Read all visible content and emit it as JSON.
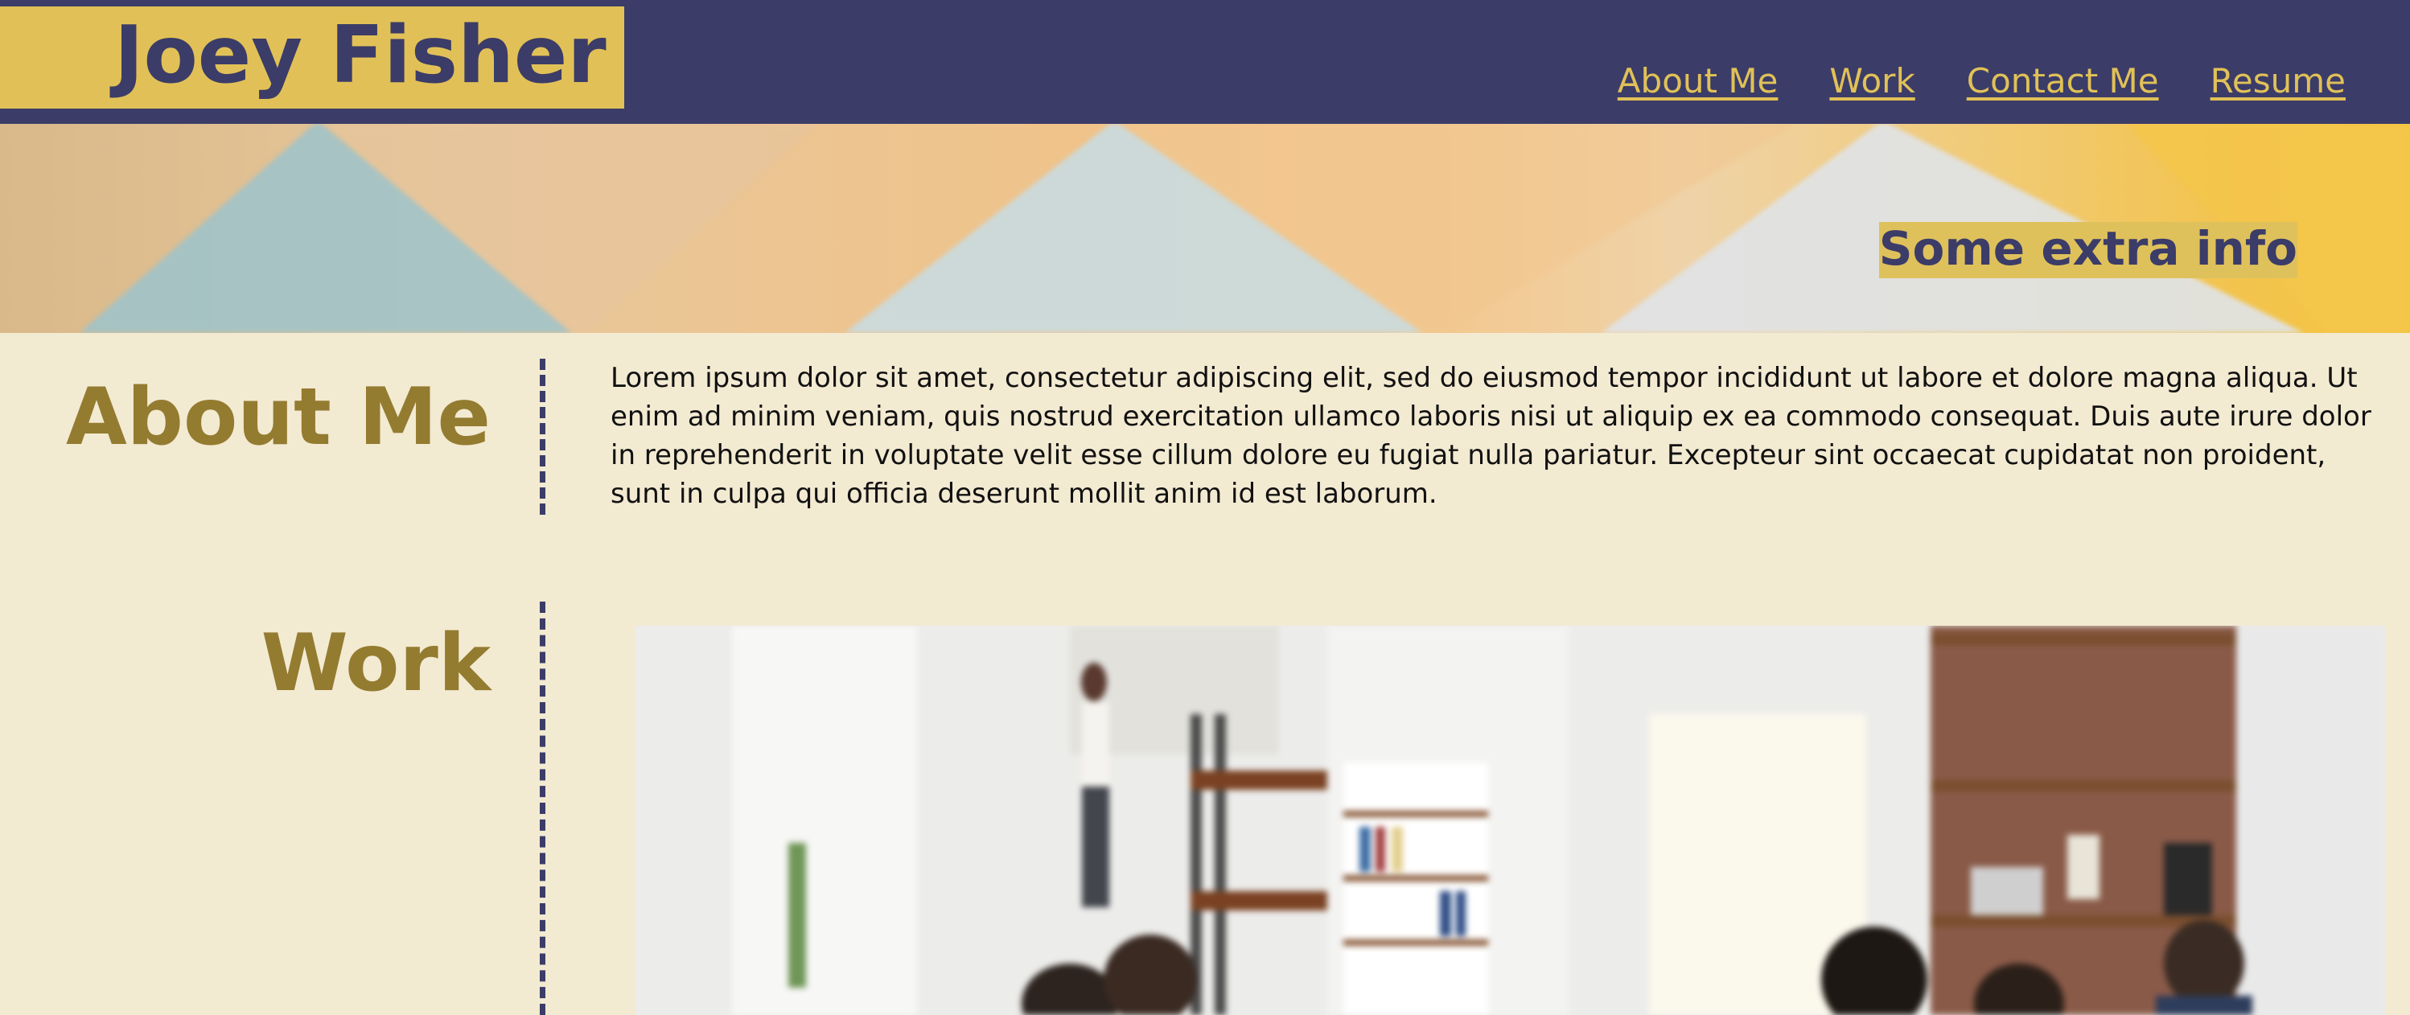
{
  "header": {
    "brand": "Joey Fisher",
    "nav": [
      {
        "label": "About Me"
      },
      {
        "label": "Work"
      },
      {
        "label": "Contact Me"
      },
      {
        "label": "Resume"
      }
    ],
    "colors": {
      "background": "#3b3c68",
      "accent": "#e1c157"
    }
  },
  "banner": {
    "extra_info": "Some extra info"
  },
  "about": {
    "title": "About Me",
    "text": "Lorem ipsum dolor sit amet, consectetur adipiscing elit, sed do eiusmod tempor incididunt ut labore et dolore magna aliqua. Ut enim ad minim veniam, quis nostrud exercitation ullamco laboris nisi ut aliquip ex ea commodo consequat. Duis aute irure dolor in reprehenderit in voluptate velit esse cillum dolore eu fugiat nulla pariatur. Excepteur sint occaecat cupidatat non proident, sunt in culpa qui officia deserunt mollit anim id est laborum."
  },
  "work": {
    "title": "Work"
  },
  "colors": {
    "page_background": "#f3ead2",
    "section_title": "#937b30",
    "divider": "#3b3c68"
  }
}
